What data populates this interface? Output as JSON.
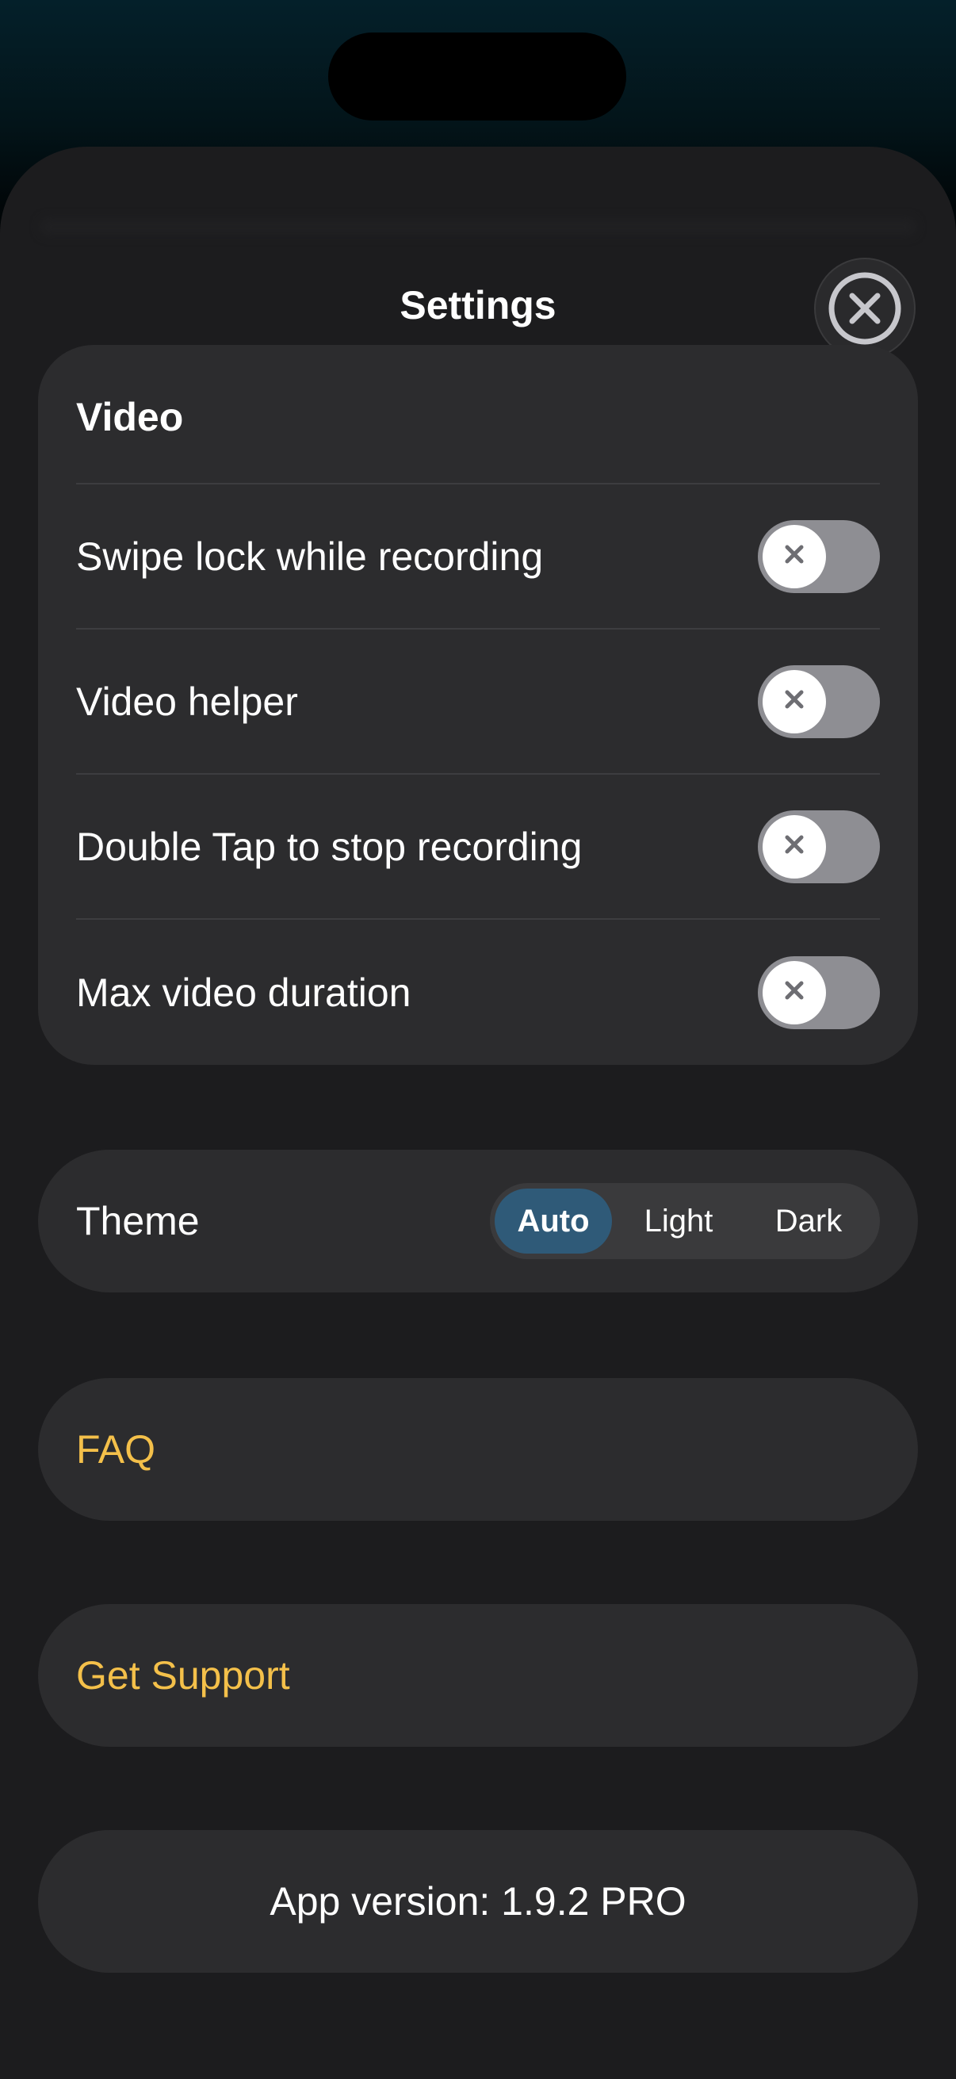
{
  "sheet": {
    "title": "Settings"
  },
  "video_section": {
    "title": "Video",
    "settings": [
      {
        "label": "Swipe lock while recording",
        "enabled": false
      },
      {
        "label": "Video helper",
        "enabled": false
      },
      {
        "label": "Double Tap to stop recording",
        "enabled": false
      },
      {
        "label": "Max video duration",
        "enabled": false
      }
    ]
  },
  "theme": {
    "label": "Theme",
    "options": [
      "Auto",
      "Light",
      "Dark"
    ],
    "selected": "Auto"
  },
  "links": {
    "faq": "FAQ",
    "support": "Get Support"
  },
  "app_version": "App version: 1.9.2 PRO",
  "colors": {
    "background": "#1c1c1e",
    "card": "#2c2c2e",
    "accent_link": "#f4c04a",
    "segment_active": "#2f5a78",
    "toggle_off": "#8e8e93"
  },
  "icons": {
    "close": "close-circle-icon",
    "toggle_off": "x-mark-icon"
  }
}
